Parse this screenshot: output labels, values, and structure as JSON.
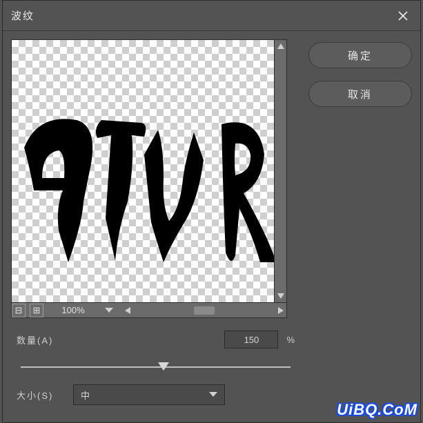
{
  "title": "波纹",
  "buttons": {
    "ok": "确定",
    "cancel": "取消",
    "close_icon": "close-icon",
    "minus": "⊟",
    "plus": "⊞"
  },
  "zoom": {
    "percent": "100%",
    "chevron": "⌄"
  },
  "amount": {
    "label": "数量(A)",
    "value": "150",
    "unit": "%",
    "slider_position_pct": 53
  },
  "size": {
    "label": "大小(S)",
    "selected": "中"
  },
  "preview_text": "ATUR",
  "watermark": "UiBQ.CoM"
}
